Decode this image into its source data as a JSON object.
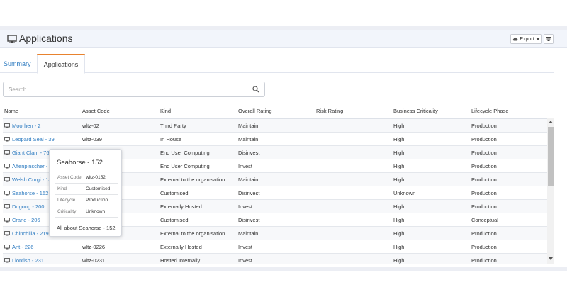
{
  "page": {
    "title": "Applications"
  },
  "toolbar": {
    "export_label": "Export",
    "export_icon": "cloud-icon",
    "filter_icon": "columns-icon"
  },
  "tabs": [
    {
      "label": "Summary",
      "active": false
    },
    {
      "label": "Applications",
      "active": true
    }
  ],
  "search": {
    "placeholder": "Search...",
    "value": ""
  },
  "table": {
    "headers": [
      "Name",
      "Asset Code",
      "Kind",
      "Overall Rating",
      "Risk Rating",
      "Business Criticality",
      "Lifecycle Phase"
    ],
    "rows": [
      {
        "name": "Moorhen - 2",
        "asset": "wltz-02",
        "kind": "Third Party",
        "overall": "Maintain",
        "risk": "",
        "criticality": "High",
        "phase": "Production"
      },
      {
        "name": "Leopard Seal - 39",
        "asset": "wltz-039",
        "kind": "In House",
        "overall": "Maintain",
        "risk": "",
        "criticality": "High",
        "phase": "Production"
      },
      {
        "name": "Giant Clam - 76",
        "asset": "",
        "kind": "End User Computing",
        "overall": "Disinvest",
        "risk": "",
        "criticality": "High",
        "phase": "Production"
      },
      {
        "name": "Affenpinscher - 1",
        "asset": "",
        "kind": "End User Computing",
        "overall": "Invest",
        "risk": "",
        "criticality": "High",
        "phase": "Production"
      },
      {
        "name": "Welsh Corgi - 14",
        "asset": "",
        "kind": "External to the organisation",
        "overall": "Maintain",
        "risk": "",
        "criticality": "High",
        "phase": "Production"
      },
      {
        "name": "Seahorse - 152",
        "asset": "",
        "kind": "Customised",
        "overall": "Disinvest",
        "risk": "",
        "criticality": "Unknown",
        "phase": "Production"
      },
      {
        "name": "Dugong - 200",
        "asset": "",
        "kind": "Externally Hosted",
        "overall": "Invest",
        "risk": "",
        "criticality": "High",
        "phase": "Production"
      },
      {
        "name": "Crane - 206",
        "asset": "",
        "kind": "Customised",
        "overall": "Disinvest",
        "risk": "",
        "criticality": "High",
        "phase": "Conceptual"
      },
      {
        "name": "Chinchilla - 219",
        "asset": "",
        "kind": "External to the organisation",
        "overall": "Maintain",
        "risk": "",
        "criticality": "High",
        "phase": "Production"
      },
      {
        "name": "Ant - 226",
        "asset": "wltz-0226",
        "kind": "Externally Hosted",
        "overall": "Invest",
        "risk": "",
        "criticality": "High",
        "phase": "Production"
      },
      {
        "name": "Lionfish - 231",
        "asset": "wltz-0231",
        "kind": "Hosted Internally",
        "overall": "Invest",
        "risk": "",
        "criticality": "High",
        "phase": "Production"
      }
    ]
  },
  "popup": {
    "title": "Seahorse - 152",
    "fields": [
      {
        "key": "Asset Code",
        "value": "wltz-0152"
      },
      {
        "key": "Kind",
        "value": "Customised"
      },
      {
        "key": "Lifecycle",
        "value": "Production"
      },
      {
        "key": "Criticality",
        "value": "Unknown"
      }
    ],
    "more_label": "All about Seahorse - 152"
  },
  "colors": {
    "link": "#2f7cc1",
    "tab_accent": "#e8822e",
    "header_bg": "#f2f5fb"
  }
}
